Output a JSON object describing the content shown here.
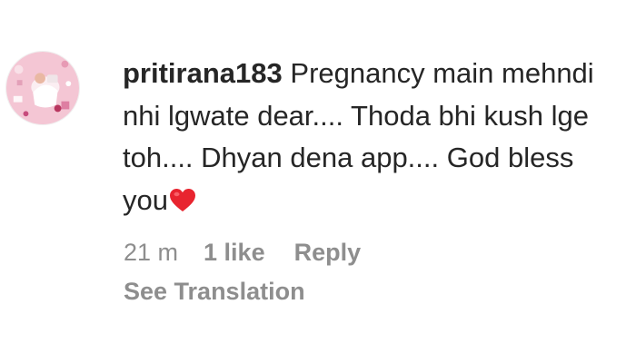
{
  "comment": {
    "username": "pritirana183",
    "text": "Pregnancy main mehndi nhi lgwate dear.... Thoda bhi kush lge toh.... Dhyan dena app.... God bless you",
    "emoji": "heart-icon",
    "emoji_color": "#e8242f"
  },
  "meta": {
    "time": "21 m",
    "likes": "1 like",
    "reply": "Reply"
  },
  "translation": {
    "label": "See Translation"
  },
  "colors": {
    "text": "#262626",
    "secondary": "#8e8e8e",
    "avatar_bg": "#f4c6d4"
  }
}
